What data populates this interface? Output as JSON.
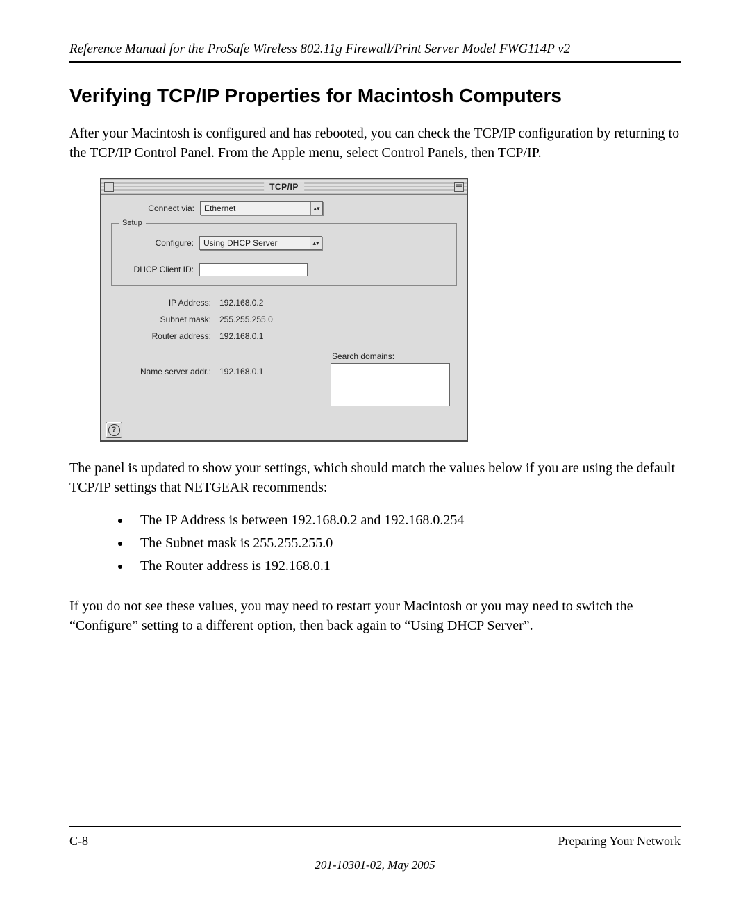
{
  "header": "Reference Manual for the ProSafe Wireless 802.11g  Firewall/Print Server Model FWG114P v2",
  "section_title": "Verifying TCP/IP Properties for Macintosh Computers",
  "intro": "After your Macintosh is configured and has rebooted, you can check the TCP/IP configuration by returning to the TCP/IP Control Panel. From the Apple menu, select Control Panels, then TCP/IP.",
  "screenshot": {
    "title": "TCP/IP",
    "connect_via_label": "Connect via:",
    "connect_via_value": "Ethernet",
    "setup_legend": "Setup",
    "configure_label": "Configure:",
    "configure_value": "Using DHCP Server",
    "dhcp_label": "DHCP Client ID:",
    "dhcp_value": "",
    "ip_label": "IP Address:",
    "ip_value": "192.168.0.2",
    "subnet_label": "Subnet mask:",
    "subnet_value": "255.255.255.0",
    "router_label": "Router address:",
    "router_value": "192.168.0.1",
    "ns_label": "Name server addr.:",
    "ns_value": "192.168.0.1",
    "sd_label": "Search domains:",
    "help_glyph": "?"
  },
  "after_ss": "The panel is updated to show your settings, which should match the values below if you are using the default TCP/IP settings that NETGEAR recommends:",
  "bullets": {
    "b1": "The IP Address is between 192.168.0.2 and 192.168.0.254",
    "b2": "The Subnet mask is 255.255.255.0",
    "b3": "The Router address is 192.168.0.1"
  },
  "closing": "If you do not see these values, you may need to restart your Macintosh or you may need to switch the “Configure” setting to a different option, then back again to “Using DHCP Server”.",
  "footer": {
    "page": "C-8",
    "section": "Preparing Your Network",
    "docid": "201-10301-02, May 2005"
  }
}
